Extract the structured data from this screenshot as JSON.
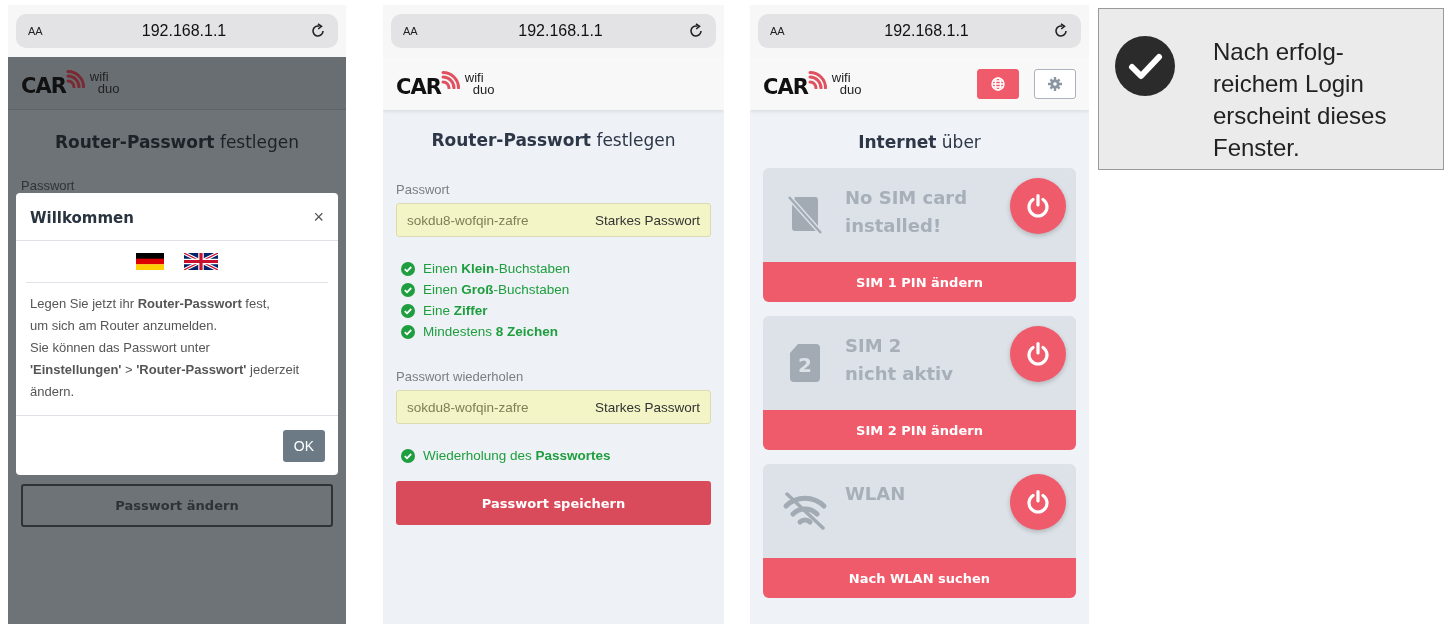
{
  "screens": [
    {
      "kind": "welcome",
      "browser": {
        "text_size": "AA",
        "address": "192.168.1.1"
      },
      "logo": {
        "main": "CAR",
        "top": "wifi",
        "bottom": "duo"
      },
      "title": "**Router-Passwort** festlegen",
      "field_label": "Passwort",
      "dialog": {
        "title": "Willkommen",
        "close": "×",
        "message": [
          "Legen Sie jetzt ihr **Router-Passwort** fest,",
          "um sich am Router anzumelden.",
          "Sie können das Passwort unter",
          "**'Einstellungen'** > **'Router-Passwort'** jederzeit",
          "ändern."
        ],
        "ok": "OK"
      },
      "button": "Passwort ändern"
    },
    {
      "kind": "password",
      "browser": {
        "text_size": "AA",
        "address": "192.168.1.1"
      },
      "logo": {
        "main": "CAR",
        "top": "wifi",
        "bottom": "duo"
      },
      "title": "**Router-Passwort** festlegen",
      "fields": [
        {
          "label": "Passwort",
          "value": "sokdu8-wofqin-zafre",
          "strength": "Starkes Passwort",
          "rules": [
            {
              "text": "Einen **Klein**-Buchstaben",
              "met": true
            },
            {
              "text": "Einen **Groß**-Buchstaben",
              "met": true
            },
            {
              "text": "Eine **Ziffer**",
              "met": true
            },
            {
              "text": "Mindestens **8 Zeichen**",
              "met": true
            }
          ]
        },
        {
          "label": "Passwort wiederholen",
          "value": "sokdu8-wofqin-zafre",
          "strength": "Starkes Passwort",
          "rules": [
            {
              "text": "Wiederholung des **Passwortes**",
              "met": true
            }
          ]
        }
      ],
      "button": "Passwort speichern"
    },
    {
      "kind": "internet",
      "browser": {
        "text_size": "AA",
        "address": "192.168.1.1"
      },
      "logo": {
        "main": "CAR",
        "top": "wifi",
        "bottom": "duo"
      },
      "header_buttons": [
        {
          "kind": "globe",
          "active": true
        },
        {
          "kind": "settings",
          "active": false
        }
      ],
      "title": "**Internet** über",
      "cards": [
        {
          "kind": "no-sim",
          "lines": [
            "No SIM card",
            "installed!"
          ],
          "action": "SIM 1 PIN ändern"
        },
        {
          "kind": "sim",
          "icon_text": "2",
          "lines": [
            "SIM 2",
            "nicht aktiv"
          ],
          "action": "SIM 2 PIN ändern"
        },
        {
          "kind": "wlan",
          "lines": [
            "WLAN"
          ],
          "action": "Nach WLAN suchen"
        }
      ]
    }
  ],
  "note": {
    "lines": [
      "Nach erfolg-",
      "reichem Login",
      "erscheint dieses",
      "Fenster."
    ]
  }
}
